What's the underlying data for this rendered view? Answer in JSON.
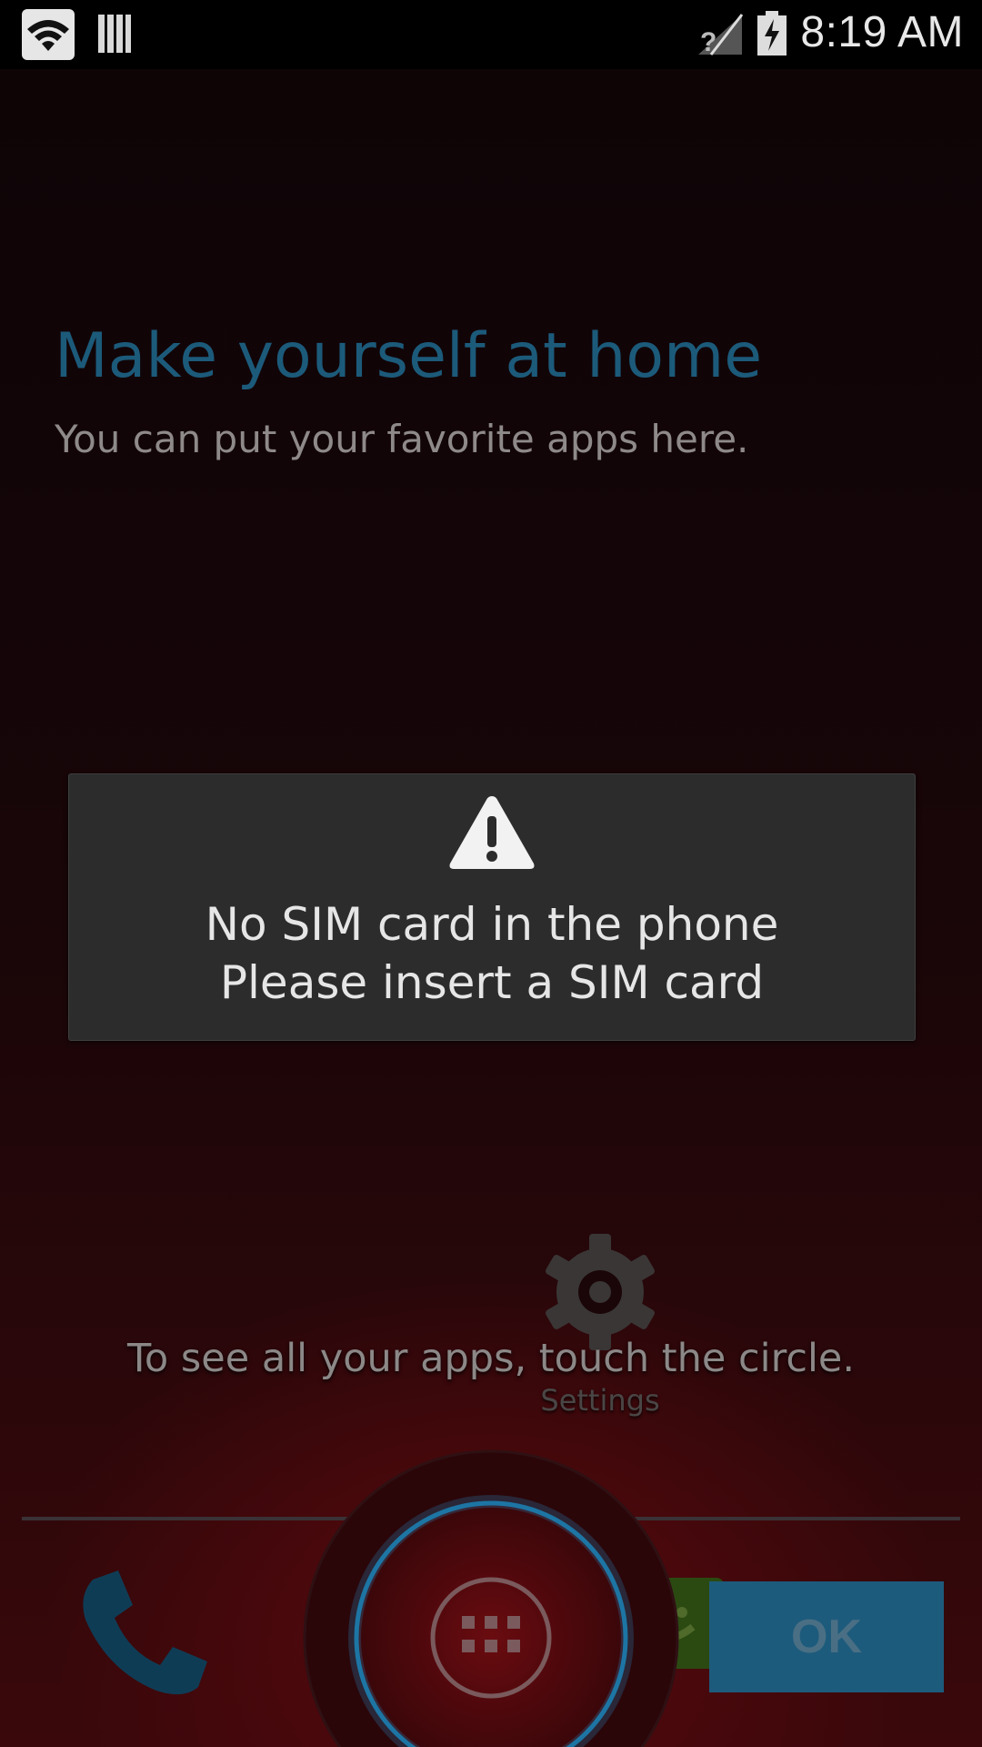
{
  "status_bar": {
    "time": "8:19 AM",
    "icons": [
      "wifi-icon",
      "notification-icon",
      "no-sim-signal-icon",
      "battery-charging-icon"
    ]
  },
  "cling": {
    "title": "Make yourself at home",
    "subtitle": "You can put your favorite apps here.",
    "apps_hint": "To see all your apps, touch the circle.",
    "ok_label": "OK"
  },
  "dialog": {
    "icon": "warning-icon",
    "line1": "No SIM card in the phone",
    "line2": "Please insert a SIM card"
  },
  "workspace": {
    "settings_label": "Settings"
  },
  "dock": {
    "icons": [
      "phone-icon",
      "all-apps-icon",
      "messaging-icon"
    ]
  },
  "colors": {
    "accent": "#1d5b7c",
    "title_blue": "#1c5a7a",
    "dialog_bg": "#2c2c2c",
    "circle_red": "#5a0a0e",
    "ring_blue": "#1a6e98"
  }
}
